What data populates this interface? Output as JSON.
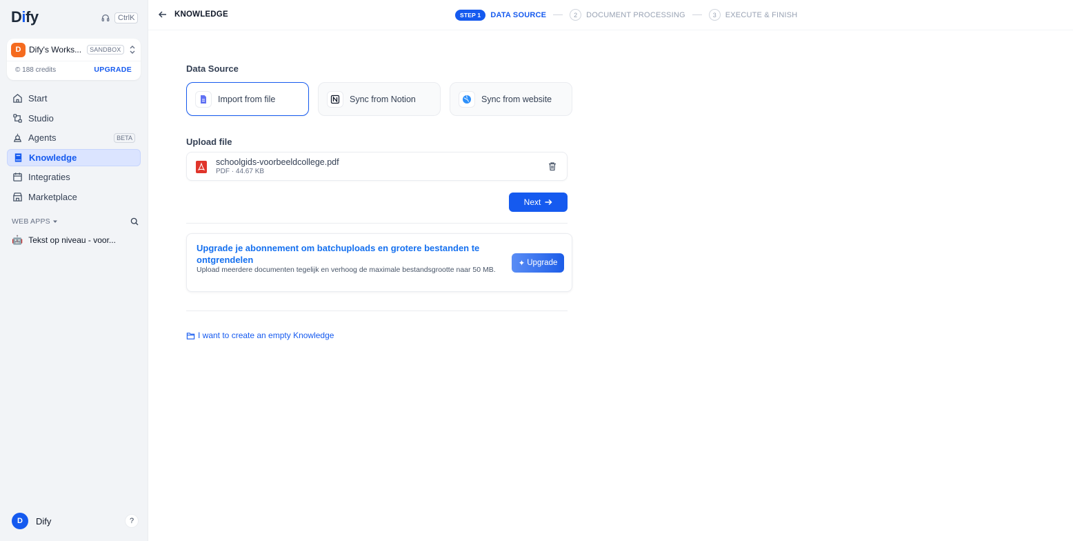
{
  "sidebar": {
    "logo": {
      "prefix": "D",
      "accent": "i",
      "suffix": "fy"
    },
    "shortcut": "CtrlK",
    "workspace": {
      "avatar": "D",
      "name": "Dify's Works...",
      "plan": "SANDBOX",
      "credits": "188 credits",
      "upgrade": "UPGRADE"
    },
    "nav": [
      {
        "label": "Start",
        "icon": "home-icon"
      },
      {
        "label": "Studio",
        "icon": "studio-icon"
      },
      {
        "label": "Agents",
        "icon": "agent-icon",
        "badge": "BETA"
      },
      {
        "label": "Knowledge",
        "icon": "book-icon",
        "active": true
      },
      {
        "label": "Integraties",
        "icon": "calendar-icon"
      },
      {
        "label": "Marketplace",
        "icon": "store-icon"
      }
    ],
    "webapps_label": "WEB APPS",
    "webapps": [
      {
        "emoji": "🤖",
        "label": "Tekst op niveau - voor..."
      }
    ],
    "user": {
      "avatar": "D",
      "name": "Dify"
    },
    "help": "?"
  },
  "header": {
    "title": "KNOWLEDGE",
    "steps": {
      "step1_pill": "STEP 1",
      "step1_label": "DATA SOURCE",
      "step2_num": "2",
      "step2_label": "DOCUMENT PROCESSING",
      "step3_num": "3",
      "step3_label": "EXECUTE & FINISH"
    }
  },
  "main": {
    "data_source_title": "Data Source",
    "sources": [
      {
        "label": "Import from file",
        "selected": true
      },
      {
        "label": "Sync from Notion",
        "selected": false
      },
      {
        "label": "Sync from website",
        "selected": false
      }
    ],
    "upload_title": "Upload file",
    "file": {
      "name": "schoolgids-voorbeeldcollege.pdf",
      "meta": "PDF · 44.67 KB"
    },
    "next_label": "Next",
    "upgrade_card": {
      "title": "Upgrade je abonnement om batchuploads en grotere bestanden te ontgrendelen",
      "description": "Upload meerdere documenten tegelijk en verhoog de maximale bestandsgrootte naar 50 MB.",
      "button": "Upgrade"
    },
    "empty_link": "I want to create an empty Knowledge"
  },
  "colors": {
    "accent": "#155aef",
    "workspace_avatar": "#f56b1f",
    "pdf_red": "#e0352b"
  }
}
